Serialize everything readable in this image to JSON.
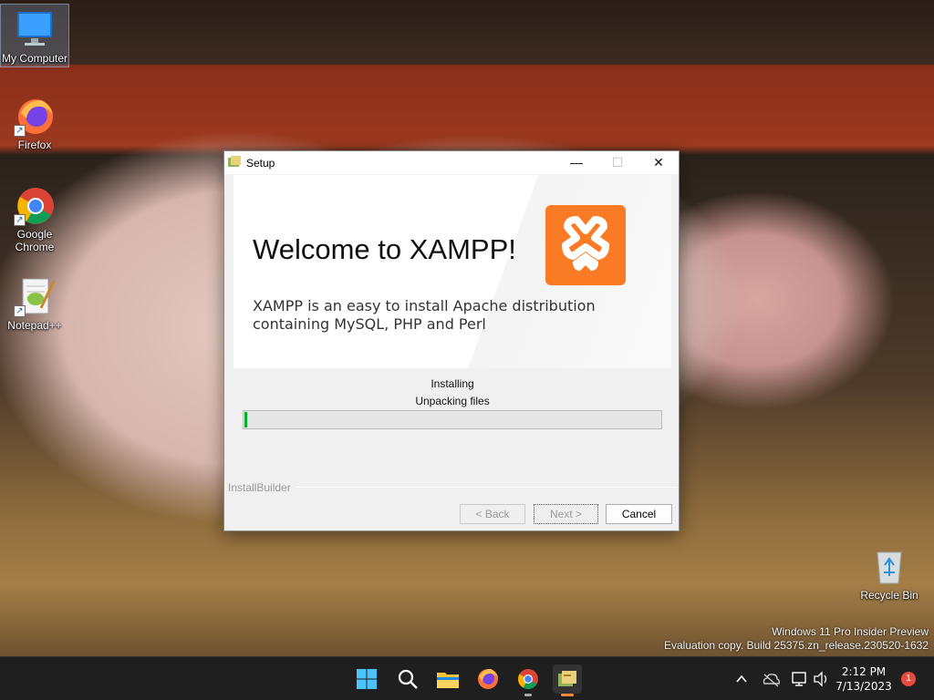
{
  "desktop": {
    "icons": [
      {
        "label": "My Computer"
      },
      {
        "label": "Firefox"
      },
      {
        "label": "Google Chrome"
      },
      {
        "label": "Notepad++"
      },
      {
        "label": "Recycle Bin"
      }
    ],
    "watermark": {
      "line1": "Windows 11 Pro Insider Preview",
      "line2": "Evaluation copy. Build 25375.zn_release.230520-1632"
    }
  },
  "setup_window": {
    "title": "Setup",
    "controls": {
      "minimize": "—",
      "maximize": "☐",
      "close": "✕"
    },
    "banner": {
      "heading": "Welcome to XAMPP!",
      "description": "XAMPP is an easy to install Apache distribution containing MySQL, PHP and Perl",
      "logo_color": "#fb7a24"
    },
    "status": {
      "line1": "Installing",
      "line2": "Unpacking files"
    },
    "progress_fraction": 0.01,
    "brand": "InstallBuilder",
    "buttons": {
      "back": "< Back",
      "next": "Next >",
      "cancel": "Cancel"
    }
  },
  "taskbar": {
    "apps": [
      "start-icon",
      "search-icon",
      "file-explorer-icon",
      "firefox-icon",
      "chrome-icon",
      "xampp-setup-icon"
    ],
    "clock": {
      "time": "2:12 PM",
      "date": "7/13/2023"
    },
    "notification_count": "1"
  }
}
